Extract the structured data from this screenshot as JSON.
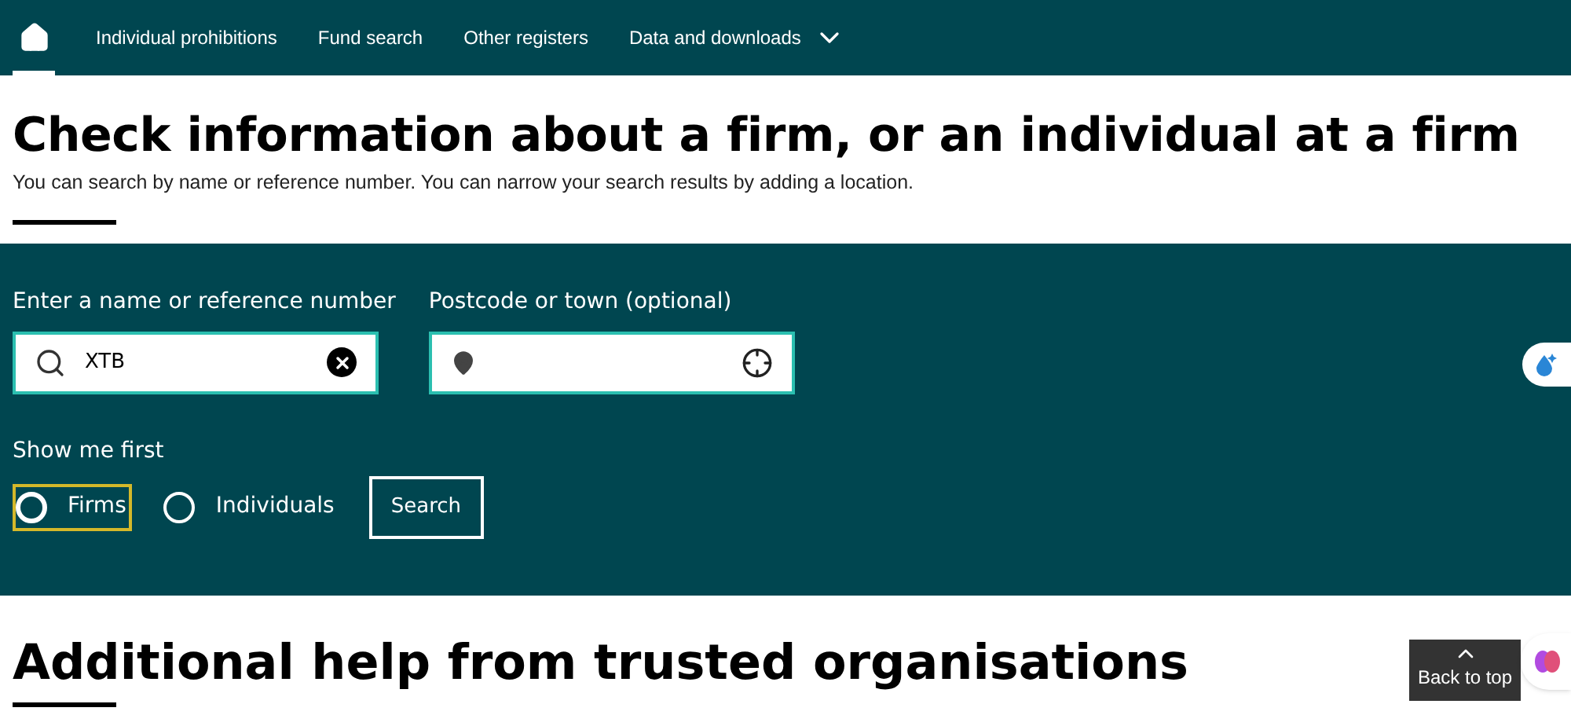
{
  "nav": {
    "items": [
      {
        "label": "Individual prohibitions"
      },
      {
        "label": "Fund search"
      },
      {
        "label": "Other registers"
      },
      {
        "label": "Data and downloads",
        "dropdown": true
      }
    ]
  },
  "header": {
    "title": "Check information about a firm, or an individual at a firm",
    "subtitle": "You can search by name or reference number. You can narrow your search results by adding a location."
  },
  "search": {
    "name_label": "Enter a name or reference number",
    "name_value": "XTB",
    "location_label": "Postcode or town (optional)",
    "show_label": "Show me first",
    "options": [
      {
        "label": "Firms",
        "selected": true
      },
      {
        "label": "Individuals",
        "selected": false
      }
    ],
    "button": "Search"
  },
  "section": {
    "title": "Additional help from trusted organisations"
  },
  "back_to_top": "Back to top"
}
